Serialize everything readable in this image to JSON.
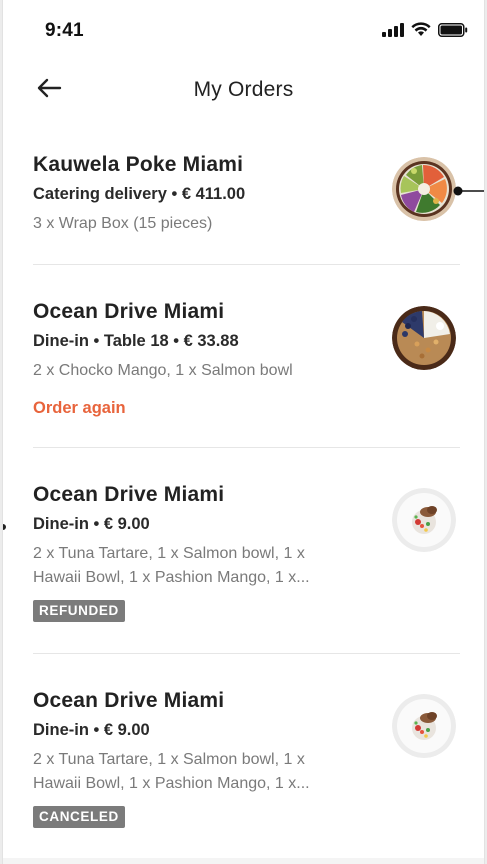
{
  "status": {
    "time": "9:41",
    "icons": [
      "signal-icon",
      "wifi-icon",
      "battery-icon"
    ]
  },
  "nav": {
    "back_icon": "arrow-left-icon",
    "title": "My Orders"
  },
  "orders": [
    {
      "restaurant": "Kauwela Poke Miami",
      "meta": "Catering delivery • € 411.00",
      "items": "3 x Wrap Box (15 pieces)",
      "thumb_icon": "poke-bowl-image"
    },
    {
      "restaurant": "Ocean Drive Miami",
      "meta": "Dine-in • Table 18 • € 33.88",
      "items": "2 x Chocko Mango, 1 x Salmon bowl",
      "action": "Order again",
      "thumb_icon": "acai-bowl-image"
    },
    {
      "restaurant": "Ocean Drive Miami",
      "meta": "Dine-in • € 9.00",
      "items_line1": "2 x Tuna Tartare, 1 x Salmon bowl, 1 x",
      "items_line2": "Hawaii Bowl, 1 x Pashion Mango, 1 x...",
      "badge": "REFUNDED",
      "thumb_icon": "tartare-plate-image"
    },
    {
      "restaurant": "Ocean Drive Miami",
      "meta": "Dine-in • € 9.00",
      "items_line1": "2 x Tuna Tartare, 1 x Salmon bowl, 1 x",
      "items_line2": "Hawaii Bowl, 1 x Pashion Mango, 1 x...",
      "badge": "CANCELED",
      "thumb_icon": "tartare-plate-image"
    }
  ],
  "colors": {
    "accent": "#e8643c",
    "badge_bg": "#7b7b7b",
    "divider": "#e6e6e6",
    "text_primary": "#222222",
    "text_secondary": "#7a7a7a"
  }
}
